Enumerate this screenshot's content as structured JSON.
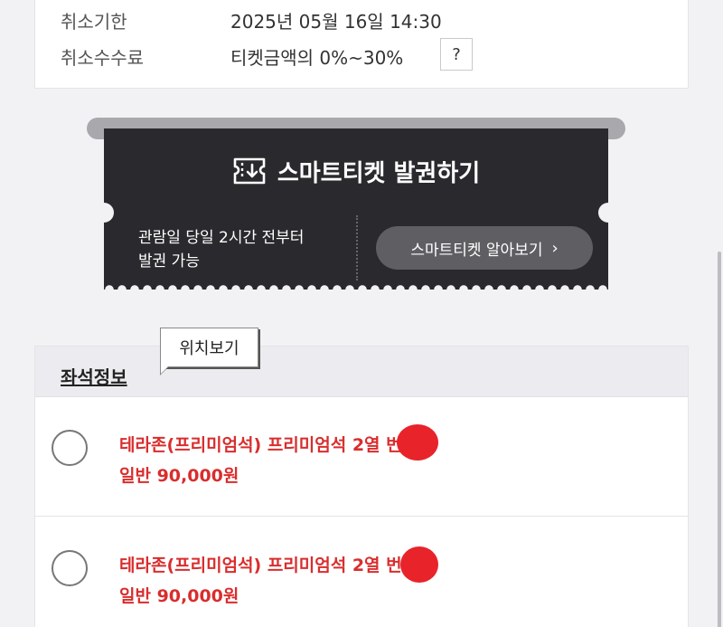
{
  "cancel_info": {
    "deadline_label": "취소기한",
    "deadline_value": "2025년 05월 16일 14:30",
    "fee_label": "취소수수료",
    "fee_value": "티켓금액의 0%~30%",
    "help_label": "?"
  },
  "smart_ticket": {
    "title": "스마트티켓 발권하기",
    "icon": "ticket-download-icon",
    "subtitle": "관람일 당일 2시간 전부터\n발권 가능",
    "learn_more_label": "스마트티켓 알아보기",
    "chevron": "›"
  },
  "tooltip": {
    "label": "위치보기"
  },
  "seat_info": {
    "title": "좌석정보",
    "items": [
      {
        "name": "테라존(프리미엄석) 프리미엄석 2열   번",
        "price": "일반 90,000원"
      },
      {
        "name": "테라존(프리미엄석) 프리미엄석 2열   번",
        "price": "일반 90,000원"
      }
    ]
  },
  "colors": {
    "accent_red": "#d92d2d",
    "ticket_dark": "#2a2a2e",
    "background": "#f2f2f4"
  }
}
